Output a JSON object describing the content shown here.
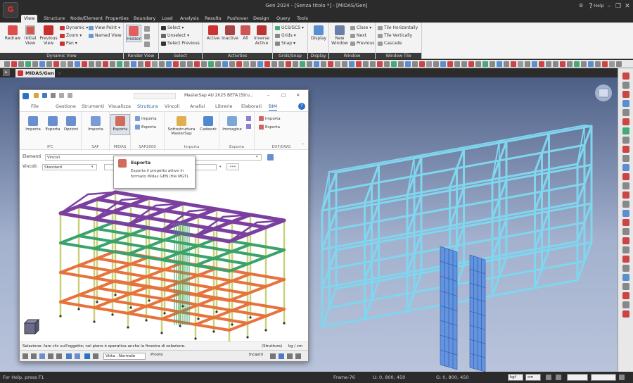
{
  "app": {
    "title": "Gen 2024 - [Senza titolo *] - [MIDAS/Gen]",
    "logo": "G",
    "help_label": "Help"
  },
  "menu_tabs": [
    "View",
    "Structure",
    "Node/Element",
    "Properties",
    "Boundary",
    "Load",
    "Analysis",
    "Results",
    "Pushover",
    "Design",
    "Query",
    "Tools"
  ],
  "ribbon": {
    "groups": [
      {
        "label": "Dynamic View",
        "buttons": [
          "Redraw",
          "Initial View",
          "Previous View"
        ],
        "small": [
          "Dynamic",
          "Zoom",
          "Pan",
          "View Point",
          "Named View"
        ]
      },
      {
        "label": "Render View",
        "buttons": [
          "Hidden"
        ]
      },
      {
        "label": "Select",
        "small": [
          "Select",
          "Unselect",
          "Select Previous"
        ]
      },
      {
        "label": "Activities",
        "buttons": [
          "Active",
          "Inactive",
          "All",
          "Inverse Active"
        ]
      },
      {
        "label": "Grids/Snap",
        "small": [
          "UCS/GCS",
          "Grids",
          "Snap"
        ]
      },
      {
        "label": "Display",
        "buttons": [
          "Display"
        ]
      },
      {
        "label": "Window",
        "buttons": [
          "New Window"
        ],
        "small": [
          "Close",
          "Next",
          "Previous"
        ]
      },
      {
        "label": "Window Tile",
        "small": [
          "Tile Horizontally",
          "Tile Vertically",
          "Cascade"
        ]
      }
    ]
  },
  "doc_tab": "MIDAS/Gen",
  "mastersap": {
    "title": "MasterSap 4U 2025 BETA [Stru...",
    "menu": [
      "File",
      "Gestione",
      "Strumenti",
      "Visualizza",
      "Struttura",
      "Vincoli",
      "Analisi",
      "Librerie",
      "Elaborati",
      "BIM"
    ],
    "active_menu": "BIM",
    "groups": [
      {
        "label": "IFC",
        "buttons": [
          "Importa",
          "Esporta",
          "Opzioni"
        ]
      },
      {
        "label": "SAF",
        "buttons": [
          "Importa"
        ]
      },
      {
        "label": "MIDAS",
        "buttons": [
          "Esporta"
        ]
      },
      {
        "label": "SAP2000",
        "small": [
          "Importa",
          "Esporta"
        ]
      },
      {
        "label": "Importa",
        "buttons": [
          "Sottostruttura MasterSap",
          "Cadwork"
        ]
      },
      {
        "label": "Esporta",
        "buttons": [
          "Immagine"
        ]
      },
      {
        "label": "DXF/DWG",
        "small": [
          "Importa",
          "Esporta"
        ]
      }
    ],
    "elementi_label": "Elementi",
    "elementi_value": "Vincoli",
    "vincoli_label": "Vincoli:",
    "vincoli_value": "Standard",
    "more": "•••",
    "status_text": "Selezione: fare clic sull'oggetto; nel piano è operativa anche la finestra di selezione.",
    "status_struttura": "(Struttura)",
    "status_units": "kg / cm",
    "vista_label": "Vista : Normale",
    "pronto": "Pronto",
    "incastri": "Incastri"
  },
  "tooltip": {
    "title": "Esporta",
    "body": "Esporta il progetto attivo in formato Midas GEN (file MGT)."
  },
  "status": {
    "help": "For Help, press F1",
    "frame": "Frame-76",
    "u": "U: 0, 800, 450",
    "g": "G: 0, 800, 450",
    "unit_force": "kgf",
    "unit_length": "cm"
  },
  "colors": {
    "dark": "#2b2b2b",
    "ribbon": "#f3f3f3",
    "accent_blue": "#1f5fa8",
    "model_blue": "#7fd6ee",
    "roof_purple": "#7b3fa0",
    "floor_green": "#3aa36b",
    "floor_orange": "#e6733b"
  }
}
